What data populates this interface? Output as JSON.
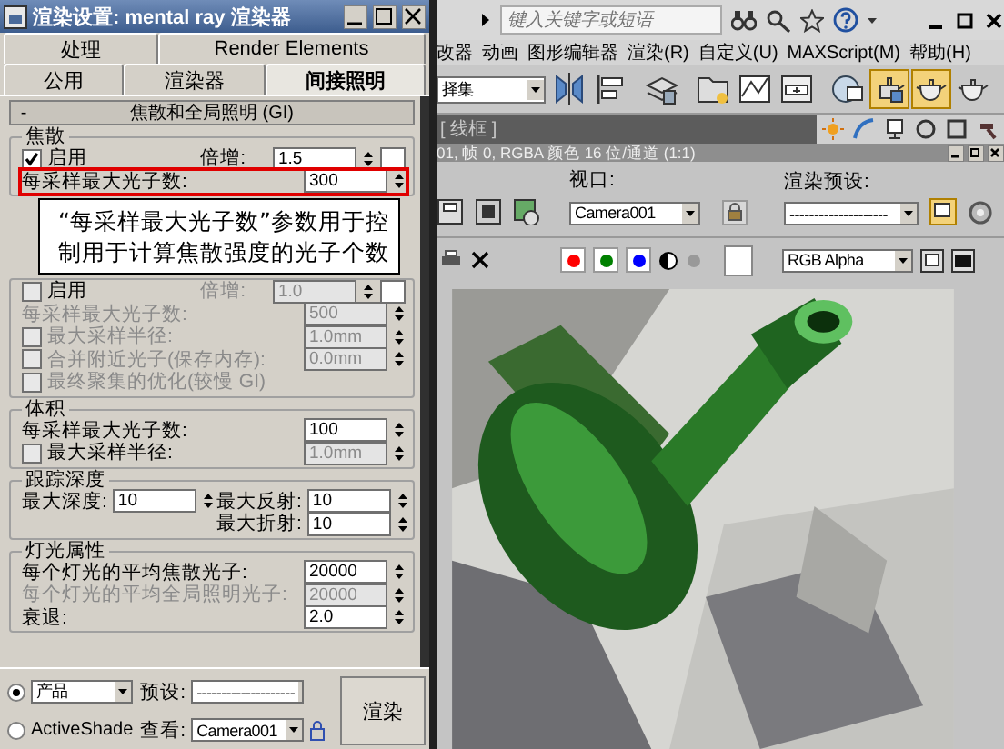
{
  "render_dialog": {
    "title": "渲染设置: mental ray 渲染器",
    "tab_rows": [
      [
        {
          "label": "处理",
          "selected": false
        },
        {
          "label": "Render Elements",
          "selected": false
        }
      ],
      [
        {
          "label": "公用",
          "selected": false
        },
        {
          "label": "渲染器",
          "selected": false
        },
        {
          "label": "间接照明",
          "selected": true
        }
      ]
    ],
    "rollout": {
      "toggle": "-",
      "title": "焦散和全局照明 (GI)"
    },
    "sections": [
      {
        "kind": "group",
        "title": "焦散",
        "rows": [
          {
            "kind": "field",
            "checked": true,
            "label": "启用",
            "side_label": "倍增:",
            "value": "1.5",
            "swatch": true
          },
          {
            "kind": "field",
            "label": "每采样最大光子数:",
            "value": "300",
            "highlighted": true
          }
        ]
      },
      {
        "kind": "callout",
        "text": "“每采样最大光子数”参数用于控制用于计算焦散强度的光子个数"
      },
      {
        "kind": "group",
        "rows": [
          {
            "kind": "field",
            "checked": false,
            "label": "启用",
            "side_label": "倍增:",
            "value": "1.0",
            "swatch": true,
            "value_disabled": true
          },
          {
            "kind": "field",
            "label": "每采样最大光子数:",
            "value": "500",
            "disabled": true
          },
          {
            "kind": "field",
            "checked": false,
            "label": "最大采样半径:",
            "value": "1.0mm",
            "disabled": true
          },
          {
            "kind": "field",
            "checked": false,
            "label": "合并附近光子(保存内存):",
            "value": "0.0mm",
            "disabled": true
          },
          {
            "kind": "check",
            "checked": false,
            "label": "最终聚集的优化(较慢 GI)",
            "disabled": true
          }
        ]
      },
      {
        "kind": "group",
        "title": "体积",
        "rows": [
          {
            "kind": "field",
            "label": "每采样最大光子数:",
            "value": "100"
          },
          {
            "kind": "field",
            "checked": false,
            "label": "最大采样半径:",
            "value": "1.0mm",
            "value_disabled": true
          }
        ]
      },
      {
        "kind": "group",
        "title": "跟踪深度",
        "rows": [
          {
            "kind": "pair",
            "left": {
              "label": "最大深度:",
              "value": "10"
            },
            "right": {
              "label": "最大反射:",
              "value": "10"
            }
          },
          {
            "kind": "pair",
            "right": {
              "label": "最大折射:",
              "value": "10"
            }
          }
        ]
      },
      {
        "kind": "group",
        "title": "灯光属性",
        "rows": [
          {
            "kind": "field",
            "label": "每个灯光的平均焦散光子:",
            "value": "20000"
          },
          {
            "kind": "field",
            "label": "每个灯光的平均全局照明光子:",
            "value": "20000",
            "disabled": true
          },
          {
            "kind": "field",
            "label": "衰退:",
            "value": "2.0"
          }
        ]
      }
    ],
    "modes": [
      {
        "kind": "dropdown",
        "value": "产品",
        "selected": true
      },
      {
        "kind": "label",
        "label": "ActiveShade",
        "selected": false
      }
    ],
    "preset": {
      "label": "预设:",
      "value": "--------------------"
    },
    "view": {
      "label": "查看:",
      "value": "Camera001"
    },
    "render_button": "渲染"
  },
  "max_window": {
    "search_placeholder": "键入关键字或短语",
    "menu": [
      "改器",
      "动画",
      "图形编辑器",
      "渲染(R)",
      "自定义(U)",
      "MAXScript(M)",
      "帮助(H)"
    ],
    "selection_set": "择集",
    "viewport_label": "[ 线框 ]",
    "frame_window": {
      "title": "01, 帧 0, RGBA 颜色 16 位/通道 (1:1)",
      "viewport_label": "视口:",
      "viewport": "Camera001",
      "preset_label": "渲染预设:",
      "preset": "--------------------",
      "channels": [
        {
          "color": "#ff0000"
        },
        {
          "color": "#008000"
        },
        {
          "color": "#0000ff"
        }
      ],
      "display": "RGB Alpha"
    }
  }
}
